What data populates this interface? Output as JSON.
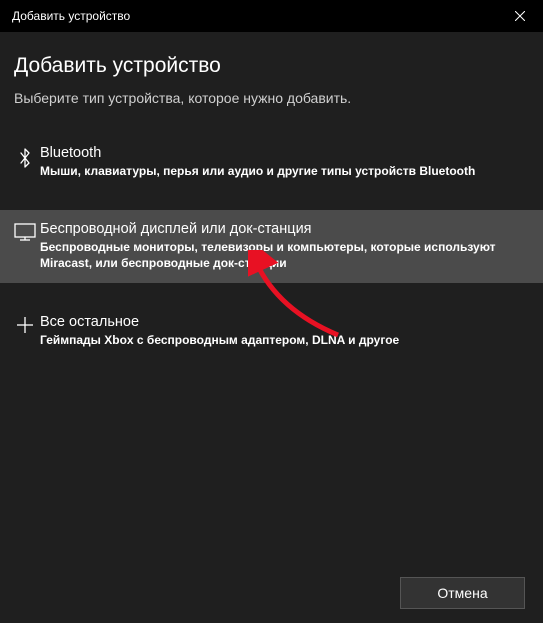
{
  "titlebar": {
    "title": "Добавить устройство"
  },
  "main": {
    "heading": "Добавить устройство",
    "subheading": "Выберите тип устройства, которое нужно добавить."
  },
  "options": {
    "bluetooth": {
      "title": "Bluetooth",
      "desc": "Мыши, клавиатуры, перья или аудио и другие типы устройств Bluetooth"
    },
    "wireless_display": {
      "title": "Беспроводной дисплей или док-станция",
      "desc": "Беспроводные мониторы, телевизоры и компьютеры, которые используют Miracast, или беспроводные док-станции"
    },
    "other": {
      "title": "Все остальное",
      "desc": "Геймпады Xbox с беспроводным адаптером, DLNA и другое"
    }
  },
  "footer": {
    "cancel_label": "Отмена"
  }
}
